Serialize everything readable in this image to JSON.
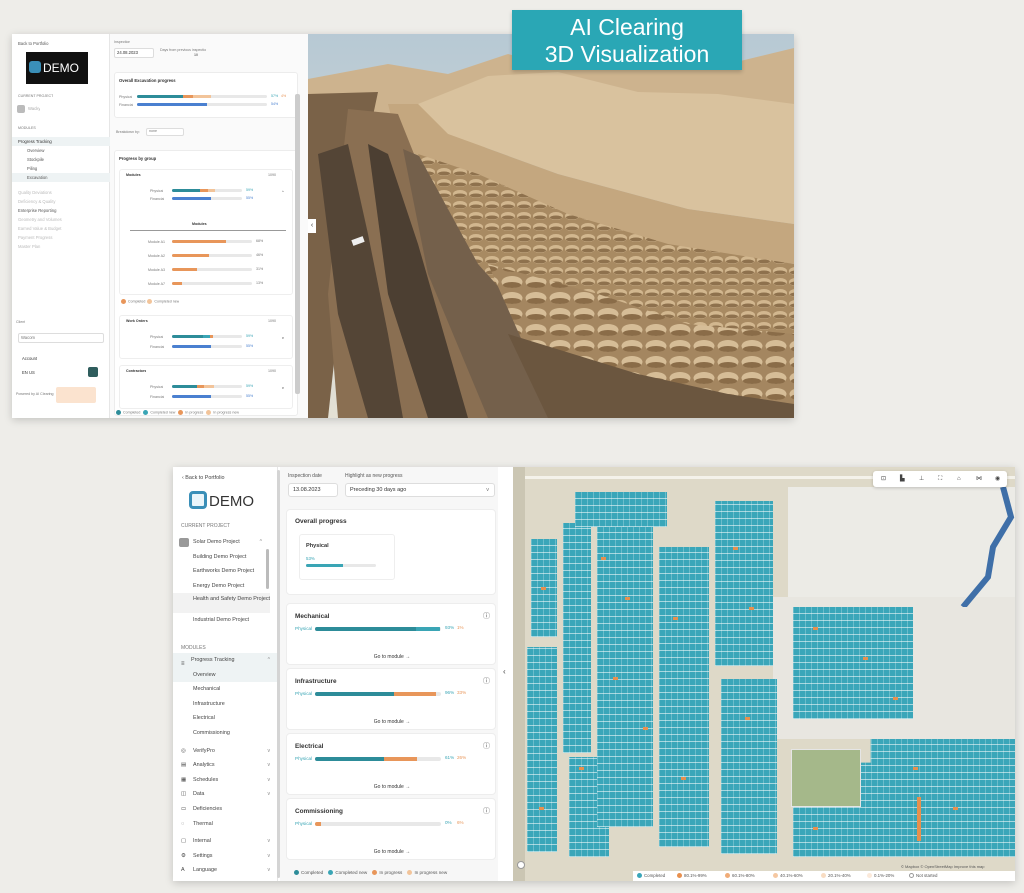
{
  "banner": {
    "line1": "AI Clearing",
    "line2": "3D Visualization"
  },
  "screen1": {
    "sidebar": {
      "back": "Back to Portfolio",
      "logo_text": "DEMO",
      "current_project_label": "CURRENT PROJECT",
      "project_name": "Wacky",
      "modules_label": "MODULES",
      "items": [
        "Progress Tracking",
        "Overview",
        "Stockpile",
        "Piling",
        "Excavation"
      ],
      "dim_items": [
        "Quality Deviations",
        "Deficiency & Quality",
        "Enterprise Reporting",
        "Geometry and Volumes",
        "Earned Value & Budget",
        "Payment Progress",
        "Master Plan"
      ],
      "client_label": "Client",
      "client_value": "Wacom",
      "account": "Account",
      "lang": "EN US",
      "footer_brand": "Powered by AI Clearing"
    },
    "inspection": {
      "label": "Inspection",
      "date": "24.08.2023",
      "days_label": "Days from previous inspection",
      "days": "10"
    },
    "overall": {
      "title": "Overall Excavation progress",
      "rows": [
        {
          "label": "Physical",
          "value": "57%",
          "delta": "4%"
        },
        {
          "label": "Financial",
          "value": "54%"
        }
      ]
    },
    "breakdown": {
      "label": "Breakdown by:",
      "value": "none"
    },
    "by_group": {
      "title": "Progress by group",
      "groups": [
        {
          "name": "Modules",
          "count": "1090"
        },
        {
          "name": "Work Orders",
          "count": "1090"
        },
        {
          "name": "Contractors",
          "count": "1090"
        }
      ],
      "rows": [
        {
          "label": "Physical",
          "value": "59%",
          "delta": "4%"
        },
        {
          "label": "Financial",
          "value": "55%"
        }
      ],
      "chart_title": "Modules",
      "modules": [
        {
          "name": "Module A1",
          "value": "68%"
        },
        {
          "name": "Module A2",
          "value": "46%"
        },
        {
          "name": "Module A3",
          "value": "31%"
        },
        {
          "name": "Module A7",
          "value": "13%"
        }
      ],
      "legend": [
        "Completed",
        "Completed new"
      ]
    },
    "footer_legend": [
      "Completed",
      "Completed new",
      "In progress",
      "In progress new"
    ]
  },
  "screen2": {
    "sidebar": {
      "back": "Back to Portfolio",
      "logo_text": "DEMO",
      "current_project_label": "CURRENT PROJECT",
      "projects": [
        "Solar Demo Project",
        "Building Demo Project",
        "Earthworks Demo Project",
        "Energy Demo Project",
        "Health and Safety Demo Project",
        "Industrial Demo Project"
      ],
      "modules_label": "MODULES",
      "progress_tracking": "Progress Tracking",
      "sub_items": [
        "Overview",
        "Mechanical",
        "Infrastructure",
        "Electrical",
        "Commissioning"
      ],
      "other_items": [
        "VerifyPro",
        "Analytics",
        "Schedules",
        "Data",
        "Deficiencies",
        "Thermal",
        "Internal",
        "Settings",
        "Language"
      ]
    },
    "inspection": {
      "label": "Inspection date",
      "date": "13.08.2023",
      "highlight_label": "Highlight as new progress",
      "highlight_value": "Preceding 30 days ago"
    },
    "overall": {
      "title": "Overall progress",
      "physical_label": "Physical",
      "physical_value": "53%"
    },
    "modules": [
      {
        "name": "Mechanical",
        "row_label": "Physical",
        "value": "93%",
        "delta": "1%",
        "link": "Go to module"
      },
      {
        "name": "Infrastructure",
        "row_label": "Physical",
        "value": "96%",
        "delta": "33%",
        "link": "Go to module"
      },
      {
        "name": "Electrical",
        "row_label": "Physical",
        "value": "61%",
        "delta": "26%",
        "link": "Go to module"
      },
      {
        "name": "Commissioning",
        "row_label": "Physical",
        "value": "0%",
        "delta": "6%",
        "link": "Go to module"
      }
    ],
    "legend": [
      "Completed",
      "Completed new",
      "In progress",
      "In progress new"
    ],
    "map_legend": [
      "Completed",
      "80.1%-99%",
      "60.1%-80%",
      "40.1%-60%",
      "20.1%-40%",
      "0.1%-20%",
      "Not started"
    ],
    "attribution": "© Mapbox © OpenStreetMap Improve this map"
  },
  "colors": {
    "teal": "#3aa5b5",
    "orange": "#e8965a",
    "banner": "#2aa7b5"
  }
}
